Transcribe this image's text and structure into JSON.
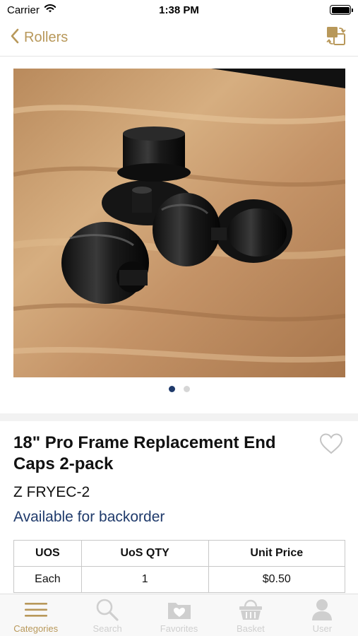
{
  "status_bar": {
    "carrier": "Carrier",
    "time": "1:38 PM"
  },
  "nav": {
    "back_label": "Rollers",
    "share_icon": "share-copy-icon",
    "accent_color": "#b8985a"
  },
  "gallery": {
    "page_count": 2,
    "current_page": 1,
    "image_description_icon": "product-photo"
  },
  "product": {
    "title": "18\" Pro Frame Replacement End Caps 2-pack",
    "sku": "Z FRYEC-2",
    "availability": "Available for backorder",
    "availability_color": "#1f3a6b"
  },
  "price_table": {
    "headers": [
      "UOS",
      "UoS QTY",
      "Unit Price"
    ],
    "rows": [
      [
        "Each",
        "1",
        "$0.50"
      ]
    ]
  },
  "tab_bar": {
    "items": [
      {
        "label": "Categories",
        "icon": "menu-lines-icon",
        "active": true
      },
      {
        "label": "Search",
        "icon": "search-icon",
        "active": false
      },
      {
        "label": "Favorites",
        "icon": "heart-folder-icon",
        "active": false
      },
      {
        "label": "Basket",
        "icon": "basket-icon",
        "active": false
      },
      {
        "label": "User",
        "icon": "user-icon",
        "active": false
      }
    ]
  }
}
